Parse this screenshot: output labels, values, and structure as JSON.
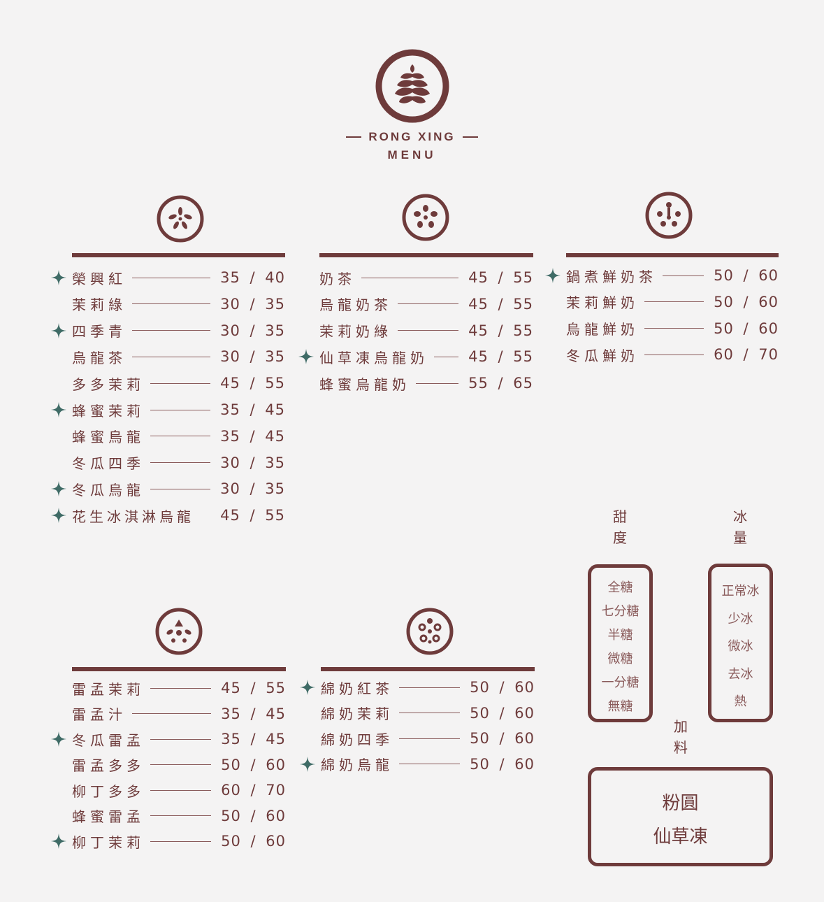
{
  "brand": {
    "name": "RONG XING",
    "subtitle": "MENU"
  },
  "sections": [
    {
      "items": [
        {
          "name": "榮興紅",
          "price": "35 / 40",
          "featured": true
        },
        {
          "name": "茉莉綠",
          "price": "30 / 35",
          "featured": false
        },
        {
          "name": "四季青",
          "price": "30 / 35",
          "featured": true
        },
        {
          "name": "烏龍茶",
          "price": "30 / 35",
          "featured": false
        },
        {
          "name": "多多茉莉",
          "price": "45 / 55",
          "featured": false
        },
        {
          "name": "蜂蜜茉莉",
          "price": "35 / 45",
          "featured": true
        },
        {
          "name": "蜂蜜烏龍",
          "price": "35 / 45",
          "featured": false
        },
        {
          "name": "冬瓜四季",
          "price": "30 / 35",
          "featured": false
        },
        {
          "name": "冬瓜烏龍",
          "price": "30 / 35",
          "featured": true
        },
        {
          "name": "花生冰淇淋烏龍",
          "price": "45 / 55",
          "featured": true
        }
      ]
    },
    {
      "items": [
        {
          "name": "奶茶",
          "price": "45 / 55",
          "featured": false
        },
        {
          "name": "烏龍奶茶",
          "price": "45 / 55",
          "featured": false
        },
        {
          "name": "茉莉奶綠",
          "price": "45 / 55",
          "featured": false
        },
        {
          "name": "仙草凍烏龍奶",
          "price": "45 / 55",
          "featured": true
        },
        {
          "name": "蜂蜜烏龍奶",
          "price": "55 / 65",
          "featured": false
        }
      ]
    },
    {
      "items": [
        {
          "name": "鍋煮鮮奶茶",
          "price": "50 / 60",
          "featured": true
        },
        {
          "name": "茉莉鮮奶",
          "price": "50 / 60",
          "featured": false
        },
        {
          "name": "烏龍鮮奶",
          "price": "50 / 60",
          "featured": false
        },
        {
          "name": "冬瓜鮮奶",
          "price": "60 / 70",
          "featured": false
        }
      ]
    },
    {
      "items": [
        {
          "name": "雷孟茉莉",
          "price": "45 / 55",
          "featured": false
        },
        {
          "name": "雷孟汁",
          "price": "35 / 45",
          "featured": false
        },
        {
          "name": "冬瓜雷孟",
          "price": "35 / 45",
          "featured": true
        },
        {
          "name": "雷孟多多",
          "price": "50 / 60",
          "featured": false
        },
        {
          "name": "柳丁多多",
          "price": "60 / 70",
          "featured": false
        },
        {
          "name": "蜂蜜雷孟",
          "price": "50 / 60",
          "featured": false
        },
        {
          "name": "柳丁茉莉",
          "price": "50 / 60",
          "featured": true
        }
      ]
    },
    {
      "items": [
        {
          "name": "綿奶紅茶",
          "price": "50 / 60",
          "featured": true
        },
        {
          "name": "綿奶茉莉",
          "price": "50 / 60",
          "featured": false
        },
        {
          "name": "綿奶四季",
          "price": "50 / 60",
          "featured": false
        },
        {
          "name": "綿奶烏龍",
          "price": "50 / 60",
          "featured": true
        }
      ]
    }
  ],
  "sweetness": {
    "label": [
      "甜",
      "度"
    ],
    "options": [
      "全糖",
      "七分糖",
      "半糖",
      "微糖",
      "一分糖",
      "無糖"
    ]
  },
  "ice": {
    "label": [
      "冰",
      "量"
    ],
    "options": [
      "正常冰",
      "少冰",
      "微冰",
      "去冰",
      "熱"
    ]
  },
  "toppings": {
    "label": [
      "加",
      "料"
    ],
    "options": [
      "粉圓",
      "仙草凍"
    ]
  },
  "colors": {
    "brand": "#6e3b3b",
    "star": "#3f6b66",
    "background": "#f4f3f3"
  },
  "icons": [
    "leaf-logo-icon",
    "star-icon",
    "section-icon"
  ]
}
